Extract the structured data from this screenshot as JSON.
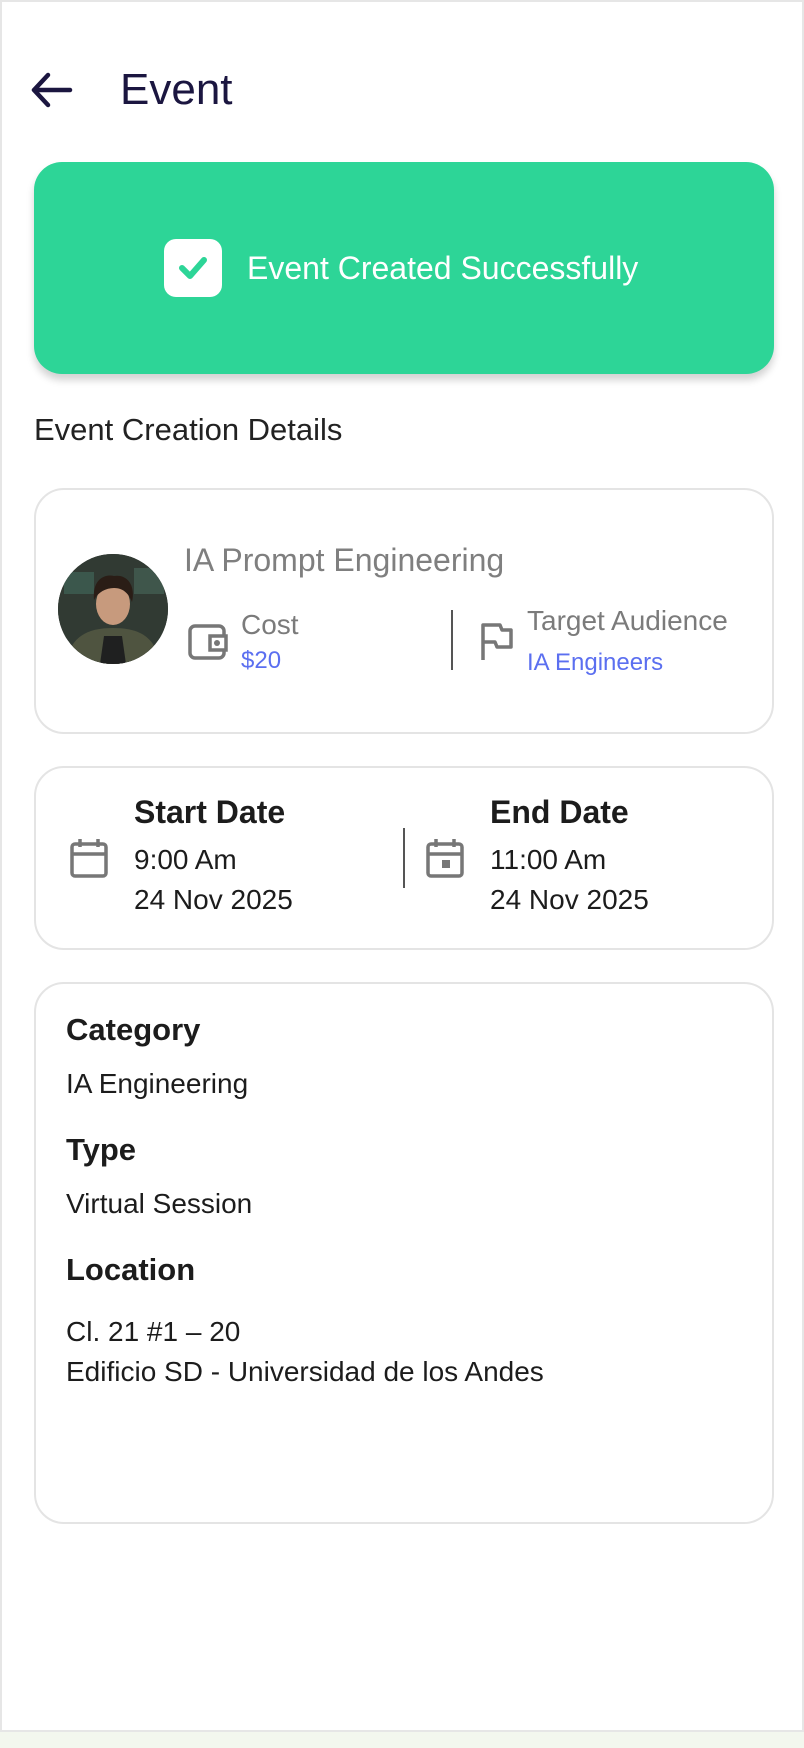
{
  "header": {
    "title": "Event",
    "back_icon": "arrow-left-icon"
  },
  "banner": {
    "text": "Event Created Successfully",
    "icon": "check-icon",
    "color": "#2dd597"
  },
  "section_title": "Event Creation Details",
  "event": {
    "name": "IA Prompt Engineering",
    "cost_label": "Cost",
    "cost_value": "$20",
    "audience_label": "Target Audience",
    "audience_value": "IA Engineers",
    "accent_color": "#5b6ff0"
  },
  "dates": {
    "start": {
      "label": "Start Date",
      "time": "9:00 Am",
      "date": "24 Nov 2025",
      "icon": "calendar-icon"
    },
    "end": {
      "label": "End Date",
      "time": "11:00 Am",
      "date": "24 Nov 2025",
      "icon": "calendar-event-icon"
    }
  },
  "details": {
    "category_label": "Category",
    "category_value": "IA Engineering",
    "type_label": "Type",
    "type_value": "Virtual Session",
    "location_label": "Location",
    "location_line1": "Cl. 21 #1 – 20",
    "location_line2": "Edificio SD - Universidad de los Andes"
  }
}
